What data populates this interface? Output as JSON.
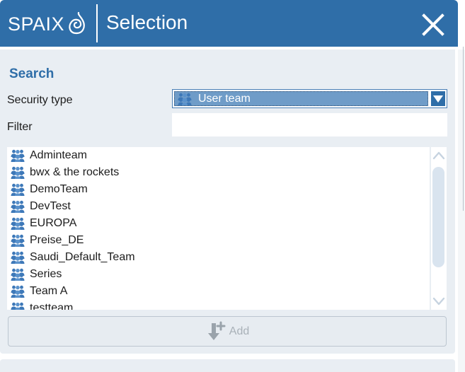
{
  "header": {
    "logo_text": "SPAIX",
    "title": "Selection",
    "close_icon": "close-icon",
    "color": "#2f6ea8"
  },
  "search": {
    "title": "Search",
    "security_type_label": "Security type",
    "security_type_value": "User team",
    "filter_label": "Filter",
    "filter_value": ""
  },
  "list": {
    "icon": "user-team-icon",
    "items": [
      "Adminteam",
      "bwx & the rockets",
      "DemoTeam",
      "DevTest",
      "EUROPA",
      "Preise_DE",
      "Saudi_Default_Team",
      "Series",
      "Team A",
      "testteam"
    ]
  },
  "actions": {
    "add_label": "Add",
    "add_icon": "add-down-arrow-icon",
    "add_disabled": true
  }
}
